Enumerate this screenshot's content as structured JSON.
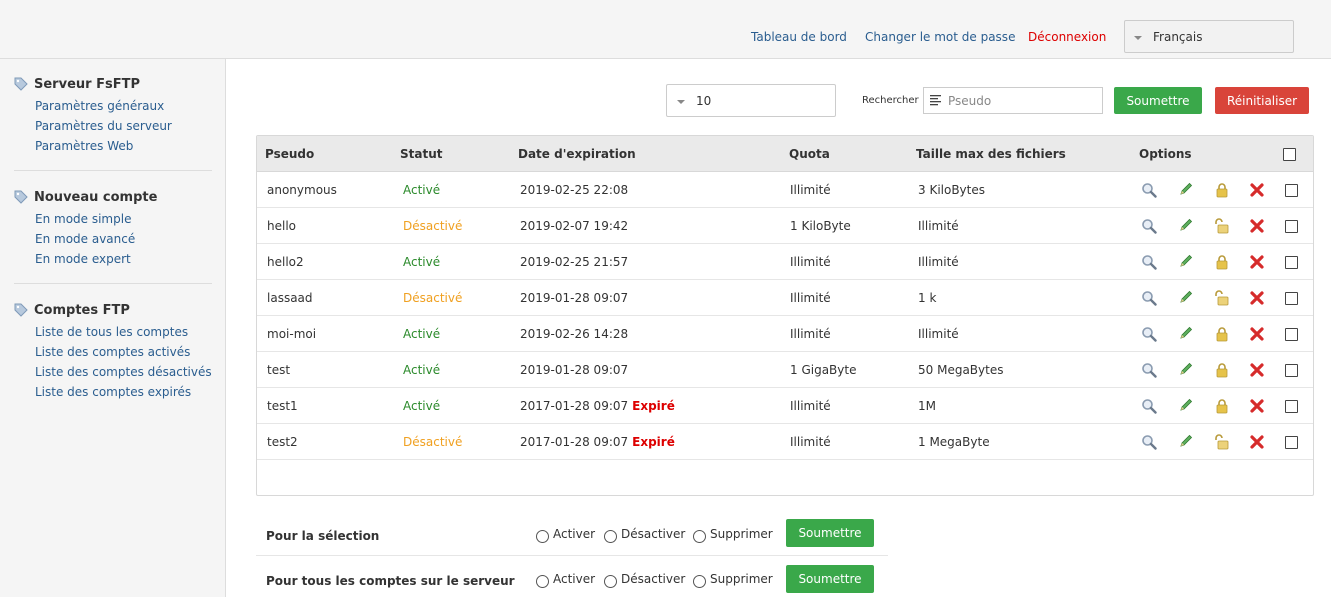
{
  "header": {
    "links": {
      "dashboard": "Tableau de bord",
      "change_password": "Changer le mot de passe",
      "logout": "Déconnexion"
    },
    "language": "Français"
  },
  "sidebar": {
    "sections": [
      {
        "title": "Serveur FsFTP",
        "items": [
          "Paramètres généraux",
          "Paramètres du serveur",
          "Paramètres Web"
        ]
      },
      {
        "title": "Nouveau compte",
        "items": [
          "En mode simple",
          "En mode avancé",
          "En mode expert"
        ]
      },
      {
        "title": "Comptes FTP",
        "items": [
          "Liste de tous les comptes",
          "Liste des comptes activés",
          "Liste des comptes désactivés",
          "Liste des comptes expirés"
        ]
      }
    ]
  },
  "controls": {
    "per_page": "10",
    "search_label": "Rechercher",
    "search_placeholder": "Pseudo",
    "submit": "Soumettre",
    "reset": "Réinitialiser"
  },
  "table": {
    "columns": [
      "Pseudo",
      "Statut",
      "Date d'expiration",
      "Quota",
      "Taille max des fichiers",
      "Options"
    ],
    "rows": [
      {
        "pseudo": "anonymous",
        "status": "Activé",
        "active": true,
        "date": "2019-02-25 22:08",
        "expired": "",
        "quota": "Illimité",
        "maxsize": "3 KiloBytes",
        "locked": true
      },
      {
        "pseudo": "hello",
        "status": "Désactivé",
        "active": false,
        "date": "2019-02-07 19:42",
        "expired": "",
        "quota": "1 KiloByte",
        "maxsize": "Illimité",
        "locked": false
      },
      {
        "pseudo": "hello2",
        "status": "Activé",
        "active": true,
        "date": "2019-02-25 21:57",
        "expired": "",
        "quota": "Illimité",
        "maxsize": "Illimité",
        "locked": true
      },
      {
        "pseudo": "lassaad",
        "status": "Désactivé",
        "active": false,
        "date": "2019-01-28 09:07",
        "expired": "",
        "quota": "Illimité",
        "maxsize": "1 k",
        "locked": false
      },
      {
        "pseudo": "moi-moi",
        "status": "Activé",
        "active": true,
        "date": "2019-02-26 14:28",
        "expired": "",
        "quota": "Illimité",
        "maxsize": "Illimité",
        "locked": true
      },
      {
        "pseudo": "test",
        "status": "Activé",
        "active": true,
        "date": "2019-01-28 09:07",
        "expired": "",
        "quota": "1 GigaByte",
        "maxsize": "50 MegaBytes",
        "locked": true
      },
      {
        "pseudo": "test1",
        "status": "Activé",
        "active": true,
        "date": "2017-01-28 09:07",
        "expired": "Expiré",
        "quota": "Illimité",
        "maxsize": "1M",
        "locked": true
      },
      {
        "pseudo": "test2",
        "status": "Désactivé",
        "active": false,
        "date": "2017-01-28 09:07",
        "expired": "Expiré",
        "quota": "Illimité",
        "maxsize": "1 MegaByte",
        "locked": false
      }
    ]
  },
  "bulk_actions": {
    "rows": [
      {
        "label": "Pour la sélection"
      },
      {
        "label": "Pour tous les comptes sur le serveur"
      }
    ],
    "options": [
      "Activer",
      "Désactiver",
      "Supprimer"
    ],
    "submit": "Soumettre"
  },
  "colors": {
    "link": "#2a5d8f",
    "active": "#2b8a2b",
    "inactive": "#f0a020",
    "danger": "#dd0000",
    "button_green": "#3aa84a",
    "button_red": "#d9443a"
  }
}
